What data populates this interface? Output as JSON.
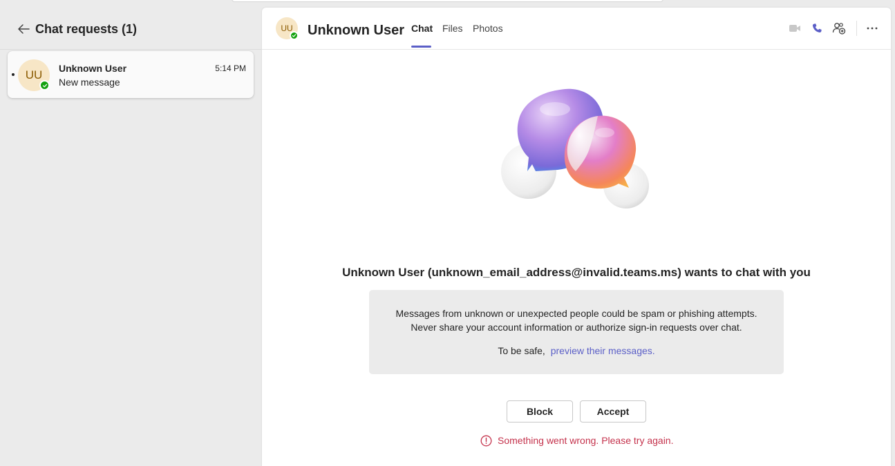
{
  "left_pane": {
    "title": "Chat requests (1)",
    "requests": [
      {
        "initials": "UU",
        "name": "Unknown User",
        "time": "5:14 PM",
        "preview": "New message",
        "presence": "available"
      }
    ]
  },
  "chat_header": {
    "initials": "UU",
    "name": "Unknown User",
    "tabs": [
      {
        "label": "Chat",
        "active": true
      },
      {
        "label": "Files",
        "active": false
      },
      {
        "label": "Photos",
        "active": false
      }
    ],
    "icons": [
      "video-call-icon",
      "audio-call-icon",
      "add-people-icon",
      "more-options-icon"
    ]
  },
  "request_body": {
    "headline": "Unknown User (unknown_email_address@invalid.teams.ms) wants to chat with you",
    "warning_line1": "Messages from unknown or unexpected people could be spam or phishing attempts.",
    "warning_line2": "Never share your account information or authorize sign-in requests over chat.",
    "safe_prefix": "To be safe,",
    "safe_link": "preview their messages.",
    "block_label": "Block",
    "accept_label": "Accept",
    "error_message": "Something went wrong. Please try again."
  },
  "colors": {
    "accent": "#5b5fc7",
    "presence_available": "#13a10e",
    "error": "#c4314b",
    "avatar_bg": "#f7e6c6"
  }
}
